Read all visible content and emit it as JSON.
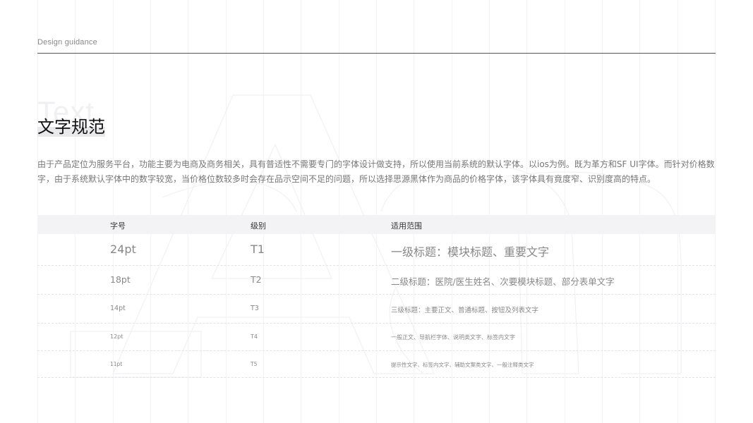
{
  "header": {
    "label": "Design guidance"
  },
  "background_word": "Text",
  "title": "文字规范",
  "description": "由于产品定位为服务平台，功能主要为电商及商务相关，具有普适性不需要专门的字体设计做支持，所以使用当前系统的默认字体。以ios为例。既为革方和SF UI字体。而针对价格数字，由于系统默认字体中的数字较宽，当价格位数较多时会存在品示空间不足的问题，所以选择思源黑体作为商品的价格字体，该字体具有竟度窄、识别度高的特点。",
  "table": {
    "headers": [
      "字号",
      "级别",
      "适用范围"
    ],
    "rows": [
      {
        "size": "24pt",
        "level": "T1",
        "usage": "一级标题：模块标题、重要文字"
      },
      {
        "size": "18pt",
        "level": "T2",
        "usage": "二级标题：医院/医生姓名、次要模块标题、部分表单文字"
      },
      {
        "size": "14pt",
        "level": "T3",
        "usage": "三级标题：主要正文、普通标题、按钮及列表文字"
      },
      {
        "size": "12pt",
        "level": "T4",
        "usage": "一般正文、导航栏字体、说明类文字、标签内文字"
      },
      {
        "size": "11pt",
        "level": "T5",
        "usage": "提示性文字、标签内文字、辅助文案类文字、一般注释类文字"
      }
    ]
  },
  "colors": {
    "background": "#ffffff",
    "title": "#111111",
    "body_text": "#777777",
    "table_header_bg": "#f3f3f5",
    "divider": "#555555"
  }
}
